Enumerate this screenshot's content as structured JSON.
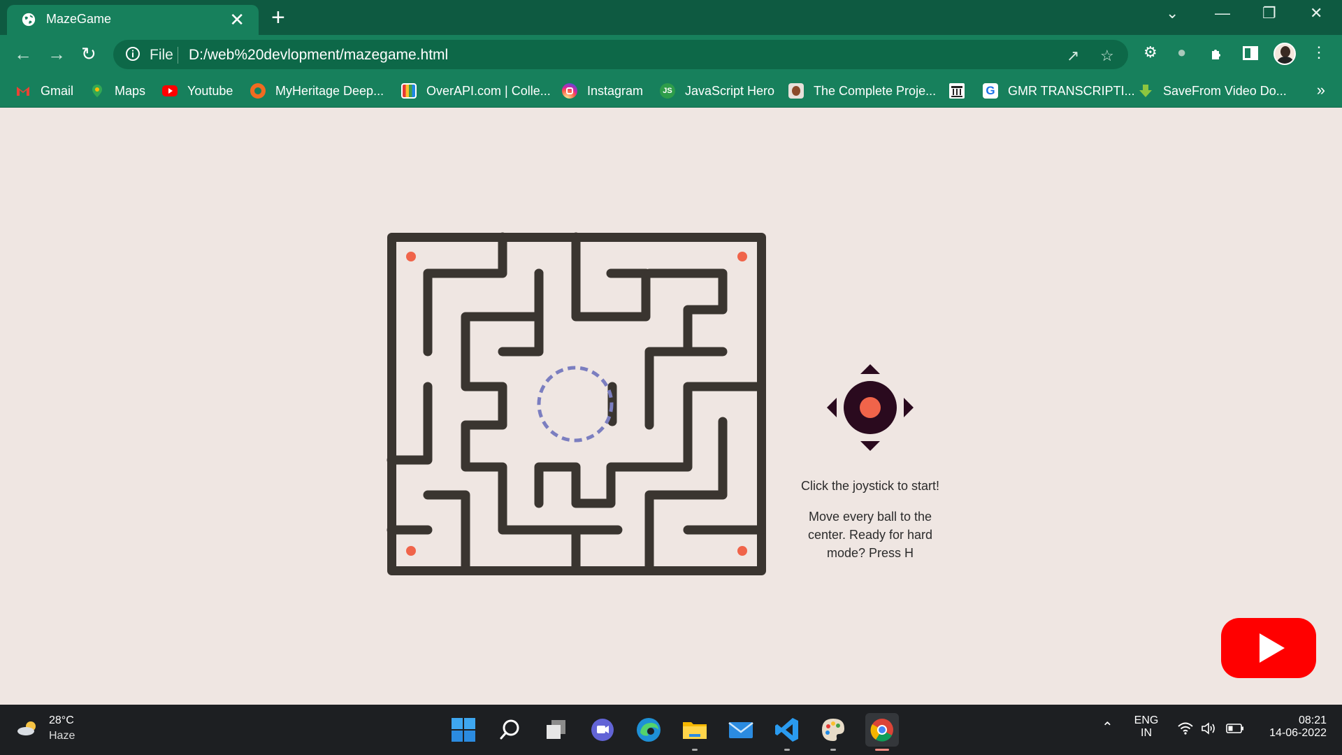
{
  "browser": {
    "tab_title": "MazeGame",
    "close_glyph": "✕",
    "new_tab_glyph": "+",
    "url_scheme_label": "File",
    "url": "D:/web%20devlopment/mazegame.html",
    "more_bookmarks_glyph": "»",
    "window_controls": {
      "dropdown": "⌄",
      "minimize": "—",
      "restore": "❐",
      "close": "✕"
    }
  },
  "bookmarks": [
    {
      "label": "Gmail",
      "icon": "gmail-icon",
      "color": "#ea4335"
    },
    {
      "label": "Maps",
      "icon": "maps-icon",
      "color": "#34a853"
    },
    {
      "label": "Youtube",
      "icon": "youtube-icon",
      "color": "#ff0000"
    },
    {
      "label": "MyHeritage Deep...",
      "icon": "myheritage-icon",
      "color": "#f26b21"
    },
    {
      "label": "OverAPI.com | Colle...",
      "icon": "overapi-icon",
      "color": "#d33"
    },
    {
      "label": "Instagram",
      "icon": "instagram-icon",
      "color": "#c13584"
    },
    {
      "label": "JavaScript Hero",
      "icon": "javascript-hero-icon",
      "color": "#2e9d4a"
    },
    {
      "label": "The Complete Proje...",
      "icon": "complete-project-icon",
      "color": "#d9d9d9"
    },
    {
      "label": "",
      "icon": "bank-icon",
      "color": "#ffffff"
    },
    {
      "label": "GMR TRANSCRIPTI...",
      "icon": "gmr-icon",
      "color": "#1a73e8"
    },
    {
      "label": "SaveFrom Video Do...",
      "icon": "savefrom-icon",
      "color": "#7bc242"
    }
  ],
  "game": {
    "instruction_start": "Click the joystick to start!",
    "instruction_goal": "Move every ball to the center. Ready for hard mode? Press H",
    "colors": {
      "wall": "#3a3530",
      "ball": "#f0644a",
      "target": "#7b7ec0",
      "joystick": "#2a0a1e"
    }
  },
  "taskbar": {
    "temperature": "28°C",
    "condition": "Haze",
    "language": "ENG",
    "region": "IN",
    "time": "08:21",
    "date": "14-06-2022",
    "apps": [
      "windows-start-icon",
      "search-icon",
      "task-view-icon",
      "teams-chat-icon",
      "edge-icon",
      "file-explorer-icon",
      "mail-icon",
      "vscode-icon",
      "paint-icon",
      "chrome-icon"
    ]
  }
}
